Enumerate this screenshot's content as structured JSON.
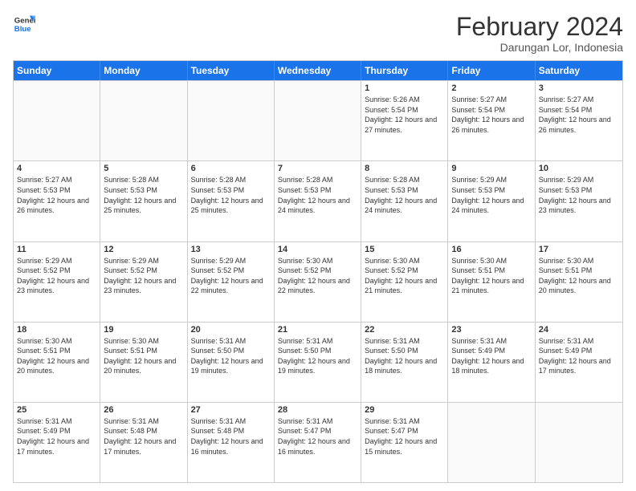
{
  "logo": {
    "line1": "General",
    "line2": "Blue"
  },
  "header": {
    "month": "February 2024",
    "location": "Darungan Lor, Indonesia"
  },
  "weekdays": [
    "Sunday",
    "Monday",
    "Tuesday",
    "Wednesday",
    "Thursday",
    "Friday",
    "Saturday"
  ],
  "rows": [
    [
      {
        "day": "",
        "info": ""
      },
      {
        "day": "",
        "info": ""
      },
      {
        "day": "",
        "info": ""
      },
      {
        "day": "",
        "info": ""
      },
      {
        "day": "1",
        "info": "Sunrise: 5:26 AM\nSunset: 5:54 PM\nDaylight: 12 hours and 27 minutes."
      },
      {
        "day": "2",
        "info": "Sunrise: 5:27 AM\nSunset: 5:54 PM\nDaylight: 12 hours and 26 minutes."
      },
      {
        "day": "3",
        "info": "Sunrise: 5:27 AM\nSunset: 5:54 PM\nDaylight: 12 hours and 26 minutes."
      }
    ],
    [
      {
        "day": "4",
        "info": "Sunrise: 5:27 AM\nSunset: 5:53 PM\nDaylight: 12 hours and 26 minutes."
      },
      {
        "day": "5",
        "info": "Sunrise: 5:28 AM\nSunset: 5:53 PM\nDaylight: 12 hours and 25 minutes."
      },
      {
        "day": "6",
        "info": "Sunrise: 5:28 AM\nSunset: 5:53 PM\nDaylight: 12 hours and 25 minutes."
      },
      {
        "day": "7",
        "info": "Sunrise: 5:28 AM\nSunset: 5:53 PM\nDaylight: 12 hours and 24 minutes."
      },
      {
        "day": "8",
        "info": "Sunrise: 5:28 AM\nSunset: 5:53 PM\nDaylight: 12 hours and 24 minutes."
      },
      {
        "day": "9",
        "info": "Sunrise: 5:29 AM\nSunset: 5:53 PM\nDaylight: 12 hours and 24 minutes."
      },
      {
        "day": "10",
        "info": "Sunrise: 5:29 AM\nSunset: 5:53 PM\nDaylight: 12 hours and 23 minutes."
      }
    ],
    [
      {
        "day": "11",
        "info": "Sunrise: 5:29 AM\nSunset: 5:52 PM\nDaylight: 12 hours and 23 minutes."
      },
      {
        "day": "12",
        "info": "Sunrise: 5:29 AM\nSunset: 5:52 PM\nDaylight: 12 hours and 23 minutes."
      },
      {
        "day": "13",
        "info": "Sunrise: 5:29 AM\nSunset: 5:52 PM\nDaylight: 12 hours and 22 minutes."
      },
      {
        "day": "14",
        "info": "Sunrise: 5:30 AM\nSunset: 5:52 PM\nDaylight: 12 hours and 22 minutes."
      },
      {
        "day": "15",
        "info": "Sunrise: 5:30 AM\nSunset: 5:52 PM\nDaylight: 12 hours and 21 minutes."
      },
      {
        "day": "16",
        "info": "Sunrise: 5:30 AM\nSunset: 5:51 PM\nDaylight: 12 hours and 21 minutes."
      },
      {
        "day": "17",
        "info": "Sunrise: 5:30 AM\nSunset: 5:51 PM\nDaylight: 12 hours and 20 minutes."
      }
    ],
    [
      {
        "day": "18",
        "info": "Sunrise: 5:30 AM\nSunset: 5:51 PM\nDaylight: 12 hours and 20 minutes."
      },
      {
        "day": "19",
        "info": "Sunrise: 5:30 AM\nSunset: 5:51 PM\nDaylight: 12 hours and 20 minutes."
      },
      {
        "day": "20",
        "info": "Sunrise: 5:31 AM\nSunset: 5:50 PM\nDaylight: 12 hours and 19 minutes."
      },
      {
        "day": "21",
        "info": "Sunrise: 5:31 AM\nSunset: 5:50 PM\nDaylight: 12 hours and 19 minutes."
      },
      {
        "day": "22",
        "info": "Sunrise: 5:31 AM\nSunset: 5:50 PM\nDaylight: 12 hours and 18 minutes."
      },
      {
        "day": "23",
        "info": "Sunrise: 5:31 AM\nSunset: 5:49 PM\nDaylight: 12 hours and 18 minutes."
      },
      {
        "day": "24",
        "info": "Sunrise: 5:31 AM\nSunset: 5:49 PM\nDaylight: 12 hours and 17 minutes."
      }
    ],
    [
      {
        "day": "25",
        "info": "Sunrise: 5:31 AM\nSunset: 5:49 PM\nDaylight: 12 hours and 17 minutes."
      },
      {
        "day": "26",
        "info": "Sunrise: 5:31 AM\nSunset: 5:48 PM\nDaylight: 12 hours and 17 minutes."
      },
      {
        "day": "27",
        "info": "Sunrise: 5:31 AM\nSunset: 5:48 PM\nDaylight: 12 hours and 16 minutes."
      },
      {
        "day": "28",
        "info": "Sunrise: 5:31 AM\nSunset: 5:47 PM\nDaylight: 12 hours and 16 minutes."
      },
      {
        "day": "29",
        "info": "Sunrise: 5:31 AM\nSunset: 5:47 PM\nDaylight: 12 hours and 15 minutes."
      },
      {
        "day": "",
        "info": ""
      },
      {
        "day": "",
        "info": ""
      }
    ]
  ]
}
